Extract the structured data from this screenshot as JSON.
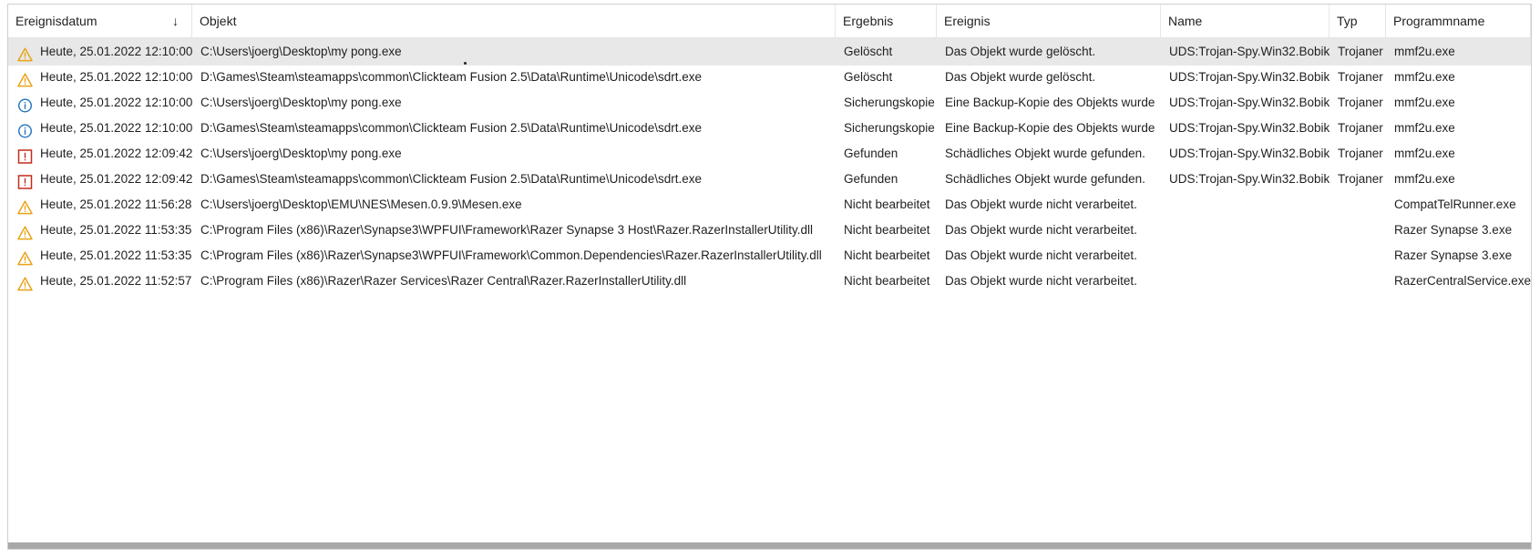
{
  "columns": {
    "date": "Ereignisdatum",
    "object": "Objekt",
    "result": "Ergebnis",
    "event": "Ereignis",
    "name": "Name",
    "type": "Typ",
    "program": "Programmname"
  },
  "sort_indicator": "↓",
  "colors": {
    "warning": "#e8a317",
    "info": "#1e73be",
    "danger": "#c42b1c",
    "selected_row": "#e8e8e8"
  },
  "rows": [
    {
      "icon": "warning-icon",
      "date": "Heute, 25.01.2022 12:10:00",
      "object": "C:\\Users\\joerg\\Desktop\\my pong.exe",
      "result": "Gelöscht",
      "event": "Das Objekt wurde gelöscht.",
      "name": "UDS:Trojan-Spy.Win32.Bobik",
      "type": "Trojaner",
      "program": "mmf2u.exe",
      "selected": true
    },
    {
      "icon": "warning-icon",
      "date": "Heute, 25.01.2022 12:10:00",
      "object": "D:\\Games\\Steam\\steamapps\\common\\Clickteam Fusion 2.5\\Data\\Runtime\\Unicode\\sdrt.exe",
      "result": "Gelöscht",
      "event": "Das Objekt wurde gelöscht.",
      "name": "UDS:Trojan-Spy.Win32.Bobik",
      "type": "Trojaner",
      "program": "mmf2u.exe"
    },
    {
      "icon": "info-icon",
      "date": "Heute, 25.01.2022 12:10:00",
      "object": "C:\\Users\\joerg\\Desktop\\my pong.exe",
      "result": "Sicherungskopie",
      "event": "Eine Backup-Kopie des Objekts wurde",
      "name": "UDS:Trojan-Spy.Win32.Bobik",
      "type": "Trojaner",
      "program": "mmf2u.exe"
    },
    {
      "icon": "info-icon",
      "date": "Heute, 25.01.2022 12:10:00",
      "object": "D:\\Games\\Steam\\steamapps\\common\\Clickteam Fusion 2.5\\Data\\Runtime\\Unicode\\sdrt.exe",
      "result": "Sicherungskopie",
      "event": "Eine Backup-Kopie des Objekts wurde",
      "name": "UDS:Trojan-Spy.Win32.Bobik",
      "type": "Trojaner",
      "program": "mmf2u.exe"
    },
    {
      "icon": "danger-icon",
      "date": "Heute, 25.01.2022 12:09:42",
      "object": "C:\\Users\\joerg\\Desktop\\my pong.exe",
      "result": "Gefunden",
      "event": "Schädliches Objekt wurde gefunden.",
      "name": "UDS:Trojan-Spy.Win32.Bobik",
      "type": "Trojaner",
      "program": "mmf2u.exe"
    },
    {
      "icon": "danger-icon",
      "date": "Heute, 25.01.2022 12:09:42",
      "object": "D:\\Games\\Steam\\steamapps\\common\\Clickteam Fusion 2.5\\Data\\Runtime\\Unicode\\sdrt.exe",
      "result": "Gefunden",
      "event": "Schädliches Objekt wurde gefunden.",
      "name": "UDS:Trojan-Spy.Win32.Bobik",
      "type": "Trojaner",
      "program": "mmf2u.exe"
    },
    {
      "icon": "warning-icon",
      "date": "Heute, 25.01.2022 11:56:28",
      "object": "C:\\Users\\joerg\\Desktop\\EMU\\NES\\Mesen.0.9.9\\Mesen.exe",
      "result": "Nicht bearbeitet",
      "event": "Das Objekt wurde nicht verarbeitet.",
      "name": "",
      "type": "",
      "program": "CompatTelRunner.exe"
    },
    {
      "icon": "warning-icon",
      "date": "Heute, 25.01.2022 11:53:35",
      "object": "C:\\Program Files (x86)\\Razer\\Synapse3\\WPFUI\\Framework\\Razer Synapse 3 Host\\Razer.RazerInstallerUtility.dll",
      "result": "Nicht bearbeitet",
      "event": "Das Objekt wurde nicht verarbeitet.",
      "name": "",
      "type": "",
      "program": "Razer Synapse 3.exe"
    },
    {
      "icon": "warning-icon",
      "date": "Heute, 25.01.2022 11:53:35",
      "object": "C:\\Program Files (x86)\\Razer\\Synapse3\\WPFUI\\Framework\\Common.Dependencies\\Razer.RazerInstallerUtility.dll",
      "result": "Nicht bearbeitet",
      "event": "Das Objekt wurde nicht verarbeitet.",
      "name": "",
      "type": "",
      "program": "Razer Synapse 3.exe"
    },
    {
      "icon": "warning-icon",
      "date": "Heute, 25.01.2022 11:52:57",
      "object": "C:\\Program Files (x86)\\Razer\\Razer Services\\Razer Central\\Razer.RazerInstallerUtility.dll",
      "result": "Nicht bearbeitet",
      "event": "Das Objekt wurde nicht verarbeitet.",
      "name": "",
      "type": "",
      "program": "RazerCentralService.exe"
    }
  ]
}
